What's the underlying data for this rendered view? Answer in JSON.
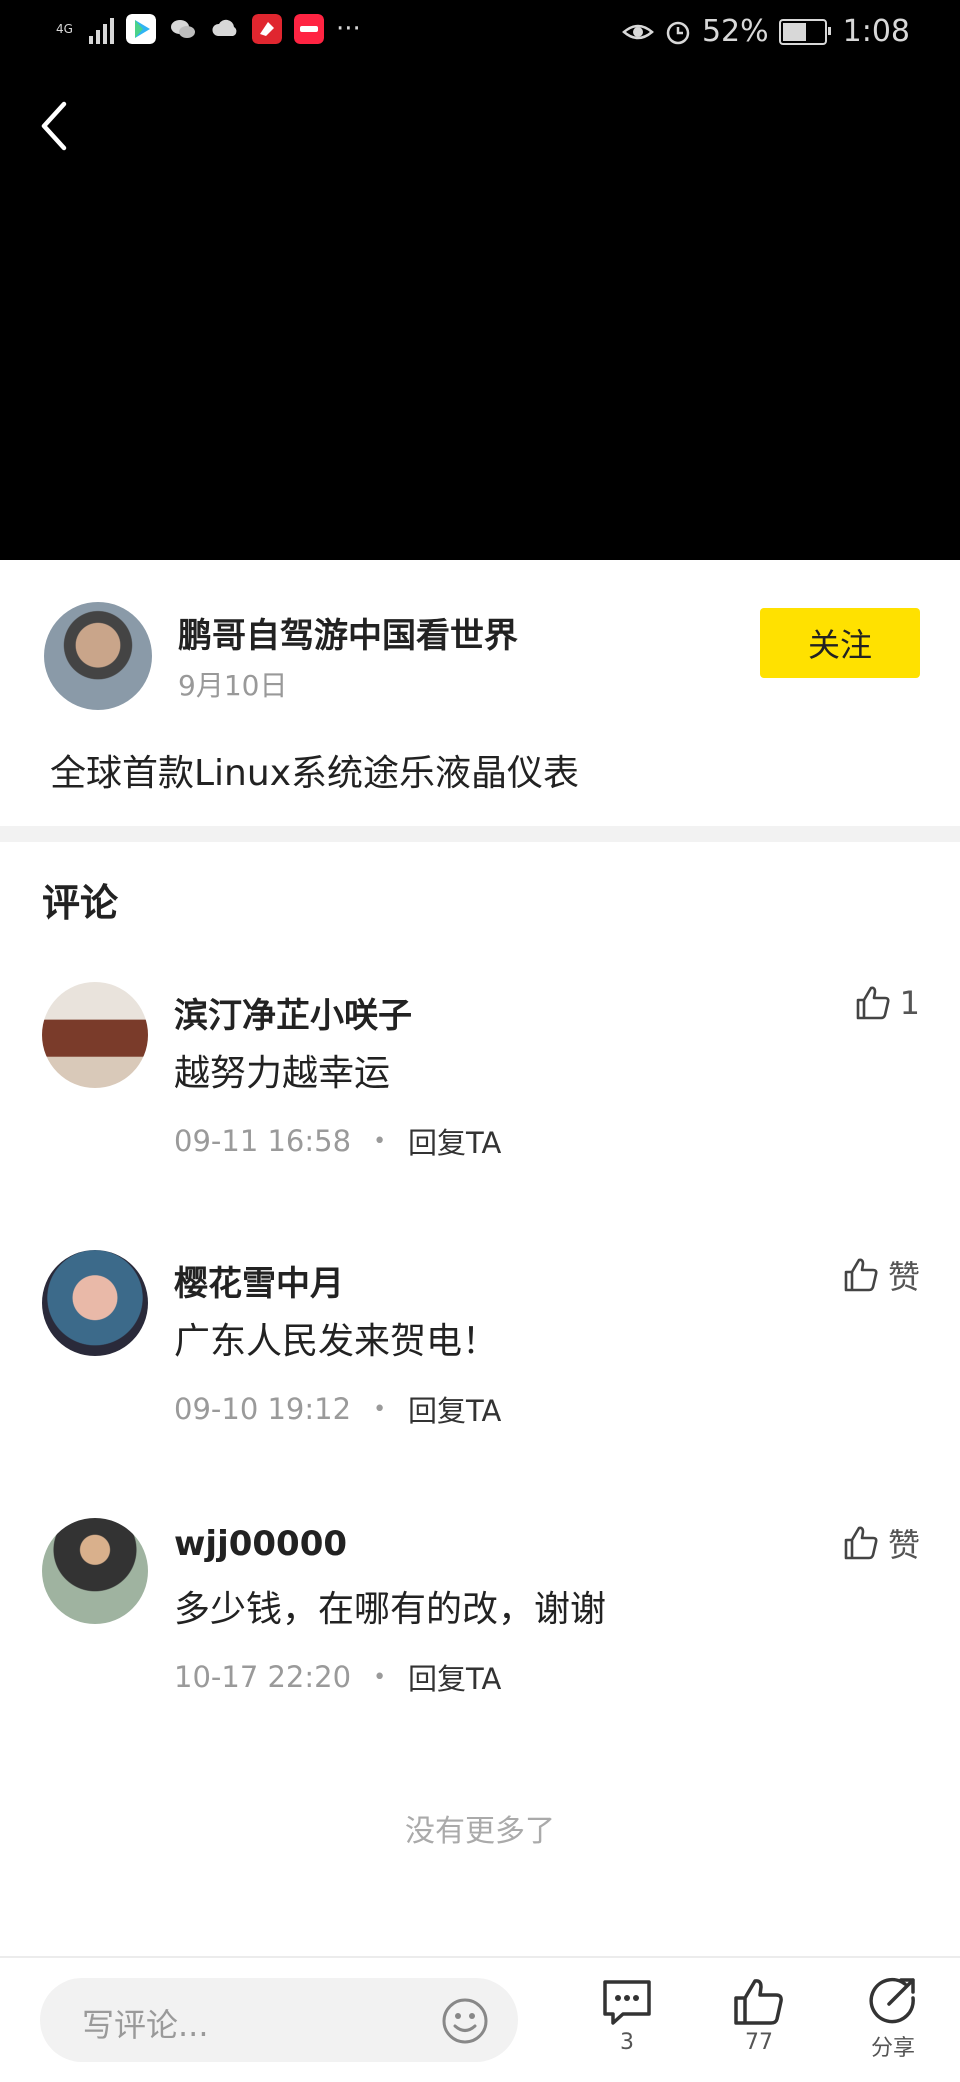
{
  "status_bar": {
    "network": "4G",
    "battery": "52%",
    "time": "1:08",
    "more": "···"
  },
  "author": {
    "name": "鹏哥自驾游中国看世界",
    "date": "9月10日",
    "follow_label": "关注"
  },
  "video_title": "全球首款Linux系统途乐液晶仪表",
  "comments_section": {
    "title": "评论",
    "items": [
      {
        "name": "滨汀净芷小咲子",
        "text": "越努力越幸运",
        "time": "09-11 16:58",
        "reply": "回复TA",
        "likes": "1"
      },
      {
        "name": "樱花雪中月",
        "text": "广东人民发来贺电！",
        "time": "09-10 19:12",
        "reply": "回复TA",
        "likes": "赞"
      },
      {
        "name": "wjj00000",
        "text": "多少钱，在哪有的改，谢谢",
        "time": "10-17 22:20",
        "reply": "回复TA",
        "likes": "赞"
      }
    ],
    "no_more": "没有更多了"
  },
  "bottom_bar": {
    "input_placeholder": "写评论...",
    "comment_count": "3",
    "like_count": "77",
    "share_label": "分享"
  },
  "colors": {
    "accent": "#ffe100",
    "video_bg": "#000000",
    "divider": "#f2f2f2"
  }
}
